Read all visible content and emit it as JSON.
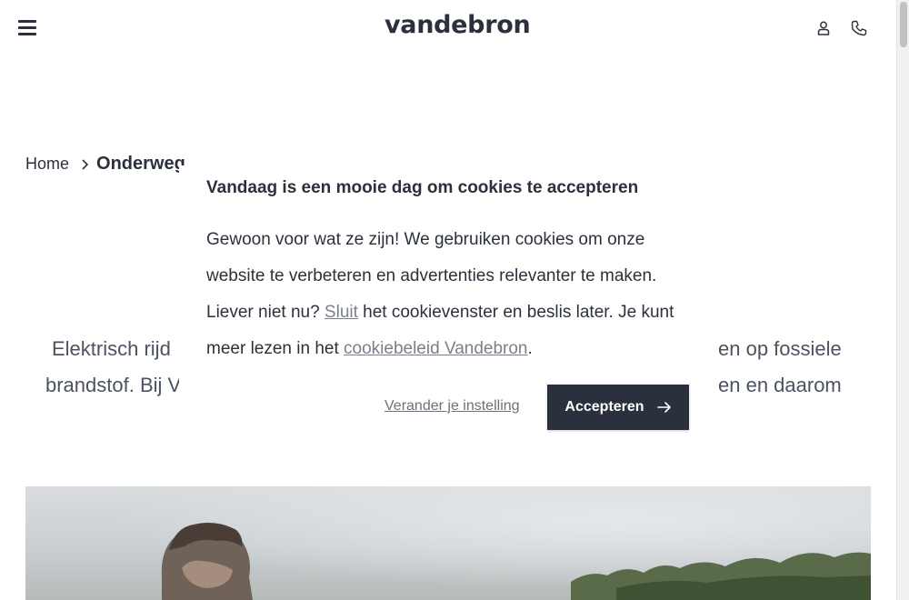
{
  "header": {
    "logo": "vandebron",
    "menu_icon": "hamburger-menu-icon",
    "account_icon": "user-icon",
    "contact_icon": "phone-icon"
  },
  "breadcrumb": {
    "home": "Home",
    "current": "Onderweg"
  },
  "intro": {
    "line1_visible_left": "Elektrisch rijd",
    "line2_visible_left": "brandstof. Bij V",
    "line1_visible_right": "en op fossiele",
    "line2_visible_right": "en en daarom"
  },
  "cookie_banner": {
    "title": "Vandaag is een mooie dag om cookies te accepteren",
    "body_part1": "Gewoon voor wat ze zijn! We gebruiken cookies om onze website te verbeteren en advertenties relevanter te maken. Liever niet nu? ",
    "close_link": "Sluit",
    "body_part2": " het cookievenster en beslis later. Je kunt meer lezen in het ",
    "policy_link": "cookiebeleid Vandebron",
    "body_part3": ".",
    "change_settings": "Verander je instelling",
    "accept": "Accepteren"
  },
  "colors": {
    "primary_dark": "#2b313c",
    "link_muted": "#7a7f88"
  }
}
